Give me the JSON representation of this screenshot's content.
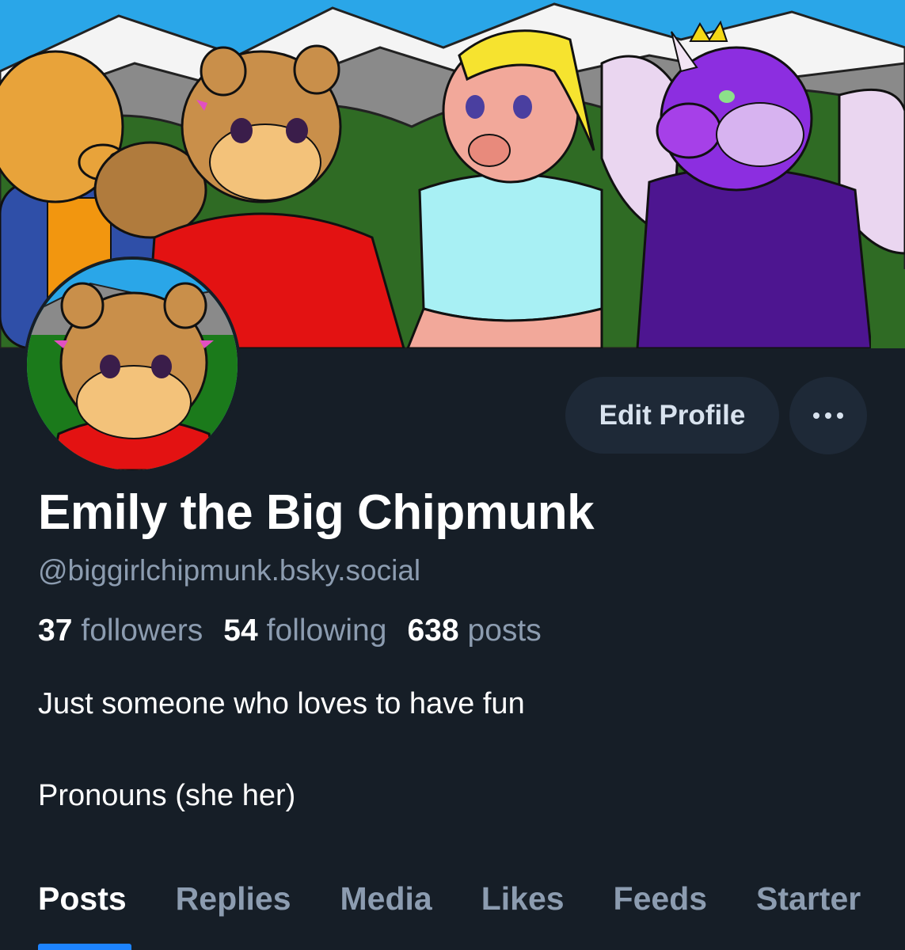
{
  "profile": {
    "display_name": "Emily the Big Chipmunk",
    "handle": "@biggirlchipmunk.bsky.social",
    "bio_line1": "Just someone who loves to have fun",
    "bio_line2": "Pronouns (she her)"
  },
  "stats": {
    "followers_count": "37",
    "followers_label": "followers",
    "following_count": "54",
    "following_label": "following",
    "posts_count": "638",
    "posts_label": "posts"
  },
  "actions": {
    "edit_label": "Edit Profile",
    "more_icon": "ellipsis-icon"
  },
  "tabs": [
    {
      "label": "Posts",
      "active": true
    },
    {
      "label": "Replies"
    },
    {
      "label": "Media"
    },
    {
      "label": "Likes"
    },
    {
      "label": "Feeds"
    },
    {
      "label": "Starter"
    }
  ],
  "colors": {
    "background": "#161e27",
    "button_bg": "#1e2937",
    "muted_text": "#8c9cb0",
    "accent": "#1d84ff"
  }
}
